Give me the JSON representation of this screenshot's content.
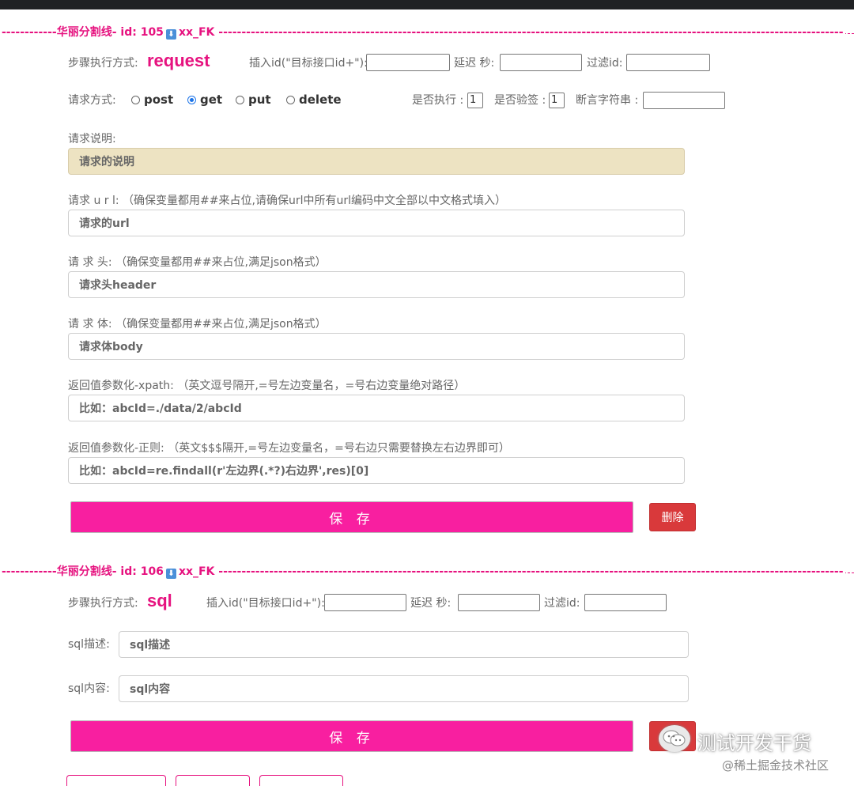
{
  "divider1": {
    "prefix": "------------华丽分割线- id: 105",
    "icon": "download-icon",
    "suffix": "xx_FK",
    "dashes": "----------------------------------------------------------------------------------------------------------------------------------------"
  },
  "step1": {
    "mode_label": "步骤执行方式:",
    "mode_value": "request",
    "insert_label": "插入id(\"目标接口id+\"):",
    "delay_label": "延迟 秒:",
    "filter_label": "过滤id:",
    "method_label": "请求方式:",
    "methods": [
      "post",
      "get",
      "put",
      "delete"
    ],
    "selected_method": "get",
    "exec_label": "是否执行 :",
    "exec_value": "1",
    "sign_label": "是否验签 :",
    "sign_value": "1",
    "assert_label": "断言字符串 :",
    "desc_label": "请求说明:",
    "desc_value": "请求的说明",
    "url_label": "请求 u r l:  （确保变量都用##来占位,请确保url中所有url编码中文全部以中文格式填入）",
    "url_placeholder": "请求的url",
    "header_label": "请 求 头:  （确保变量都用##来占位,满足json格式）",
    "header_placeholder": "请求头header",
    "body_label": "请 求 体:  （确保变量都用##来占位,满足json格式）",
    "body_placeholder": "请求体body",
    "xpath_label": "返回值参数化-xpath:  （英文逗号隔开,=号左边变量名，=号右边变量绝对路径）",
    "xpath_placeholder": "比如：abcId=./data/2/abcId",
    "regex_label": "返回值参数化-正则:  （英文$$$隔开,=号左边变量名，=号右边只需要替换左右边界即可）",
    "regex_placeholder": "比如：abcId=re.findall(r'左边界(.*?)右边界',res)[0]",
    "save_label": "保 存",
    "delete_label": "删除"
  },
  "divider2": {
    "prefix": "------------华丽分割线- id: 106",
    "icon": "download-icon",
    "suffix": "xx_FK",
    "dashes": "----------------------------------------------------------------------------------------------------------------------------------------"
  },
  "step2": {
    "mode_label": "步骤执行方式:",
    "mode_value": "sql",
    "insert_label": "插入id(\"目标接口id+\"):",
    "delay_label": "延迟 秒:",
    "filter_label": "过滤id:",
    "sqldesc_label": "sql描述:",
    "sqldesc_placeholder": "sql描述",
    "sqlcontent_label": "sql内容:",
    "sqlcontent_placeholder": "sql内容",
    "save_label": "保 存"
  },
  "watermark": {
    "line1": "测试开发干货",
    "line2": "@稀土掘金技术社区",
    "icon": "wechat-icon"
  }
}
